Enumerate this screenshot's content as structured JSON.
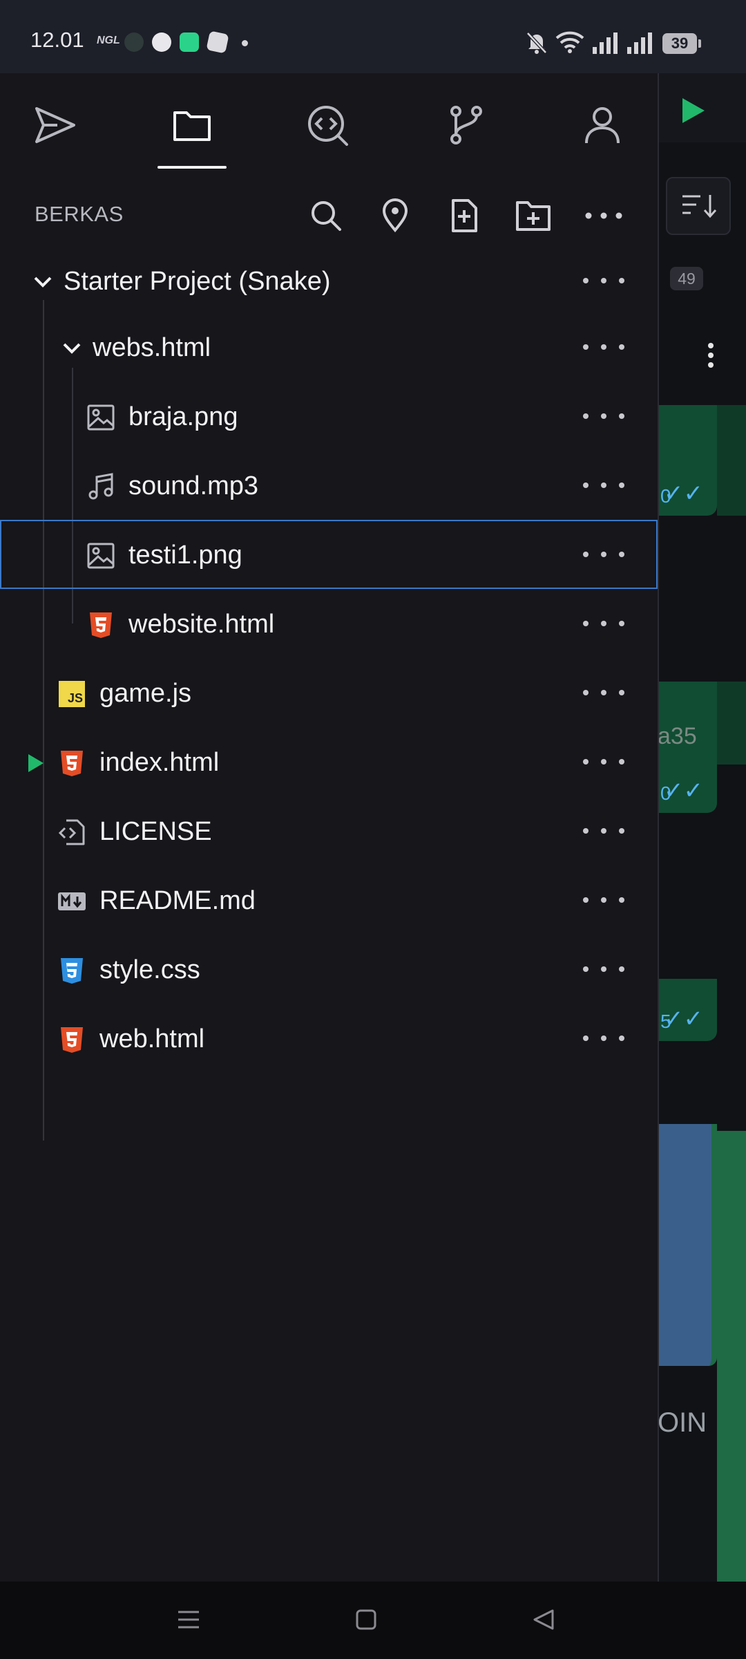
{
  "status_bar": {
    "time": "12.01",
    "left_label": "NGL",
    "battery": "39",
    "icons": [
      "nfc-app-icon",
      "chat-app-icon",
      "green-app-icon",
      "roblox-icon",
      "dot-icon",
      "mute-icon",
      "wifi-icon",
      "signal-icon",
      "signal-icon"
    ]
  },
  "drawer": {
    "tabs": [
      {
        "name": "send-icon"
      },
      {
        "name": "folder-icon",
        "active": true
      },
      {
        "name": "search-code-icon"
      },
      {
        "name": "git-branch-icon"
      },
      {
        "name": "user-icon"
      }
    ],
    "section_title": "BERKAS",
    "section_actions": [
      "search-icon",
      "location-pin-icon",
      "new-file-icon",
      "new-folder-icon",
      "more-icon"
    ],
    "tree": [
      {
        "label": "Starter Project (Snake)",
        "type": "folder",
        "expanded": true
      },
      {
        "label": "webs.html",
        "type": "folder",
        "expanded": true
      },
      {
        "label": "braja.png",
        "type": "image"
      },
      {
        "label": "sound.mp3",
        "type": "audio"
      },
      {
        "label": "testi1.png",
        "type": "image",
        "selected": true
      },
      {
        "label": "website.html",
        "type": "html"
      },
      {
        "label": "game.js",
        "type": "js",
        "badge": "JS"
      },
      {
        "label": "index.html",
        "type": "html",
        "running": true
      },
      {
        "label": "LICENSE",
        "type": "license"
      },
      {
        "label": "README.md",
        "type": "markdown"
      },
      {
        "label": "style.css",
        "type": "css"
      },
      {
        "label": "web.html",
        "type": "html"
      }
    ]
  },
  "background_app": {
    "count_badge": "49",
    "texts": [
      "a35",
      "OIN"
    ]
  },
  "colors": {
    "drawer_bg": "#16161b",
    "status_bg": "#1d1f29",
    "selection_border": "#3a78c8",
    "run_green": "#21b86b",
    "html_orange": "#e44d26",
    "css_blue": "#2d8fe0",
    "js_yellow": "#f0d84a"
  }
}
